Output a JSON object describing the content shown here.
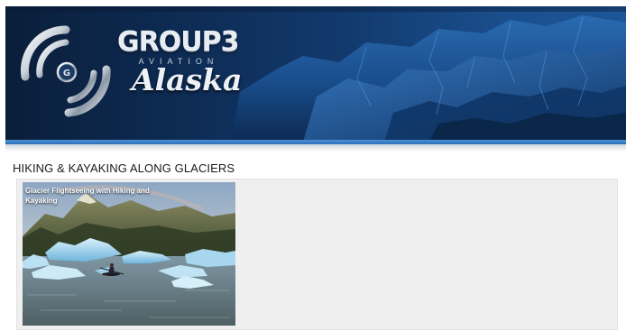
{
  "header": {
    "brand_main": "GROUP3",
    "brand_sub": "AVIATION",
    "brand_region": "Alaska",
    "logo_icon": "g3-swirl-logo-icon"
  },
  "section": {
    "title": "HIKING & KAYAKING ALONG GLACIERS"
  },
  "tiles": [
    {
      "caption": "Glacier Flightseeing with Hiking and Kayaking",
      "image": "kayaker-among-icebergs-photo"
    }
  ],
  "colors": {
    "banner_dark": "#0a1e3a",
    "banner_light": "#1d5797",
    "accent_stripe": "#4a90d6",
    "panel_bg": "#efefef",
    "title_text": "#1b1b1b"
  }
}
